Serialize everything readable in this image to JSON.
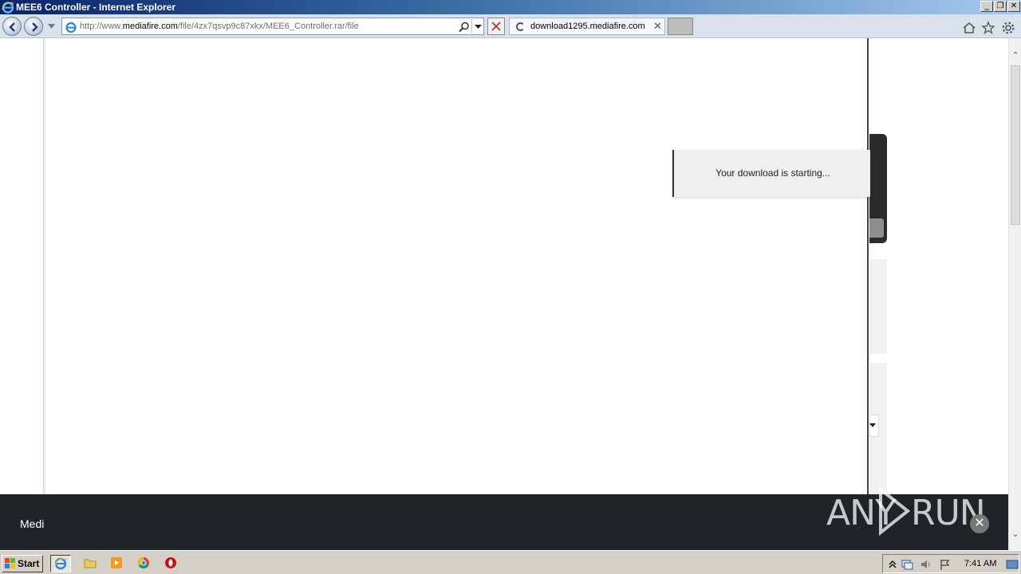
{
  "window": {
    "title": "MEE6 Controller - Internet Explorer",
    "buttons": {
      "minimize": "_",
      "restore": "❐",
      "close": "✕"
    }
  },
  "navbar": {
    "url_prefix": "http://www.",
    "url_domain": "mediafire.com",
    "url_path": "/file/4zx7qsvp9c87xkx/MEE6_Controller.rar/file",
    "tab_title": "download1295.mediafire.com",
    "tab_close": "✕",
    "stop_icon": "✕"
  },
  "page": {
    "toast_message": "Your download is starting...",
    "footer_brand": "Medi",
    "watermark_left": "ANY",
    "watermark_right": "RUN",
    "close_glyph": "✕"
  },
  "scrollbar": {
    "up": "⌃",
    "down": "⌄"
  },
  "taskbar": {
    "start_label": "Start",
    "clock": "7:41 AM"
  },
  "colors": {
    "titlebar_start": "#0a246a",
    "footer_bg": "#1f2428",
    "taskbar_bg": "#d4d0c8"
  }
}
